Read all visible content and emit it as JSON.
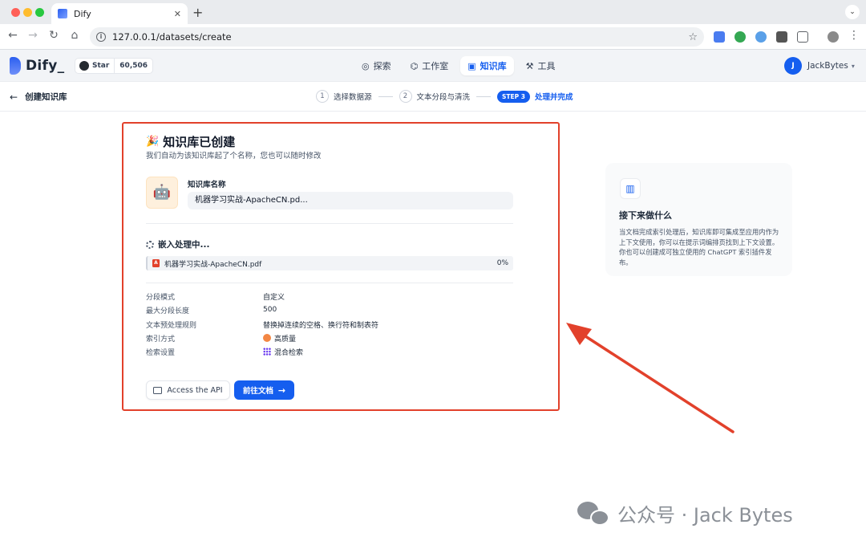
{
  "browser": {
    "tab_title": "Dify",
    "url": "127.0.0.1/datasets/create",
    "close": "✕",
    "new_tab": "+"
  },
  "header": {
    "logo": "Dify_",
    "github_star_label": "Star",
    "github_star_count": "60,506",
    "nav": [
      {
        "label": "探索",
        "icon": "compass-icon"
      },
      {
        "label": "工作室",
        "icon": "robot-icon"
      },
      {
        "label": "知识库",
        "icon": "book-icon"
      },
      {
        "label": "工具",
        "icon": "hammer-icon"
      }
    ],
    "user_initial": "J",
    "user_name": "JackBytes"
  },
  "subheader": {
    "back_label": "创建知识库",
    "steps": [
      {
        "num": "1",
        "label": "选择数据源"
      },
      {
        "num": "2",
        "label": "文本分段与清洗"
      },
      {
        "badge": "STEP 3",
        "label": "处理并完成"
      }
    ]
  },
  "main": {
    "title": "知识库已创建",
    "subtitle": "我们自动为该知识库起了个名称，您也可以随时修改",
    "kb_name_label": "知识库名称",
    "kb_name_value": "机器学习实战-ApacheCN.pd...",
    "embedding_title": "嵌入处理中...",
    "file": {
      "name": "机器学习实战-ApacheCN.pdf",
      "progress": "0%"
    },
    "info": [
      {
        "label": "分段模式",
        "value": "自定义"
      },
      {
        "label": "最大分段长度",
        "value": "500"
      },
      {
        "label": "文本预处理规则",
        "value": "替换掉连续的空格、换行符和制表符"
      },
      {
        "label": "索引方式",
        "value": "高质量",
        "icon": "high-quality-icon"
      },
      {
        "label": "检索设置",
        "value": "混合检索",
        "icon": "hybrid-search-icon"
      }
    ],
    "api_button": "Access the API",
    "go_button": "前往文档"
  },
  "side": {
    "title": "接下来做什么",
    "text": "当文档完成索引处理后，知识库即可集成至应用内作为上下文使用，你可以在提示词编排页找到上下文设置。你也可以创建成可独立使用的 ChatGPT 索引插件发布。"
  },
  "watermark": "公众号 · Jack Bytes",
  "colors": {
    "accent": "#155eef",
    "annotation_red": "#e2412b"
  }
}
